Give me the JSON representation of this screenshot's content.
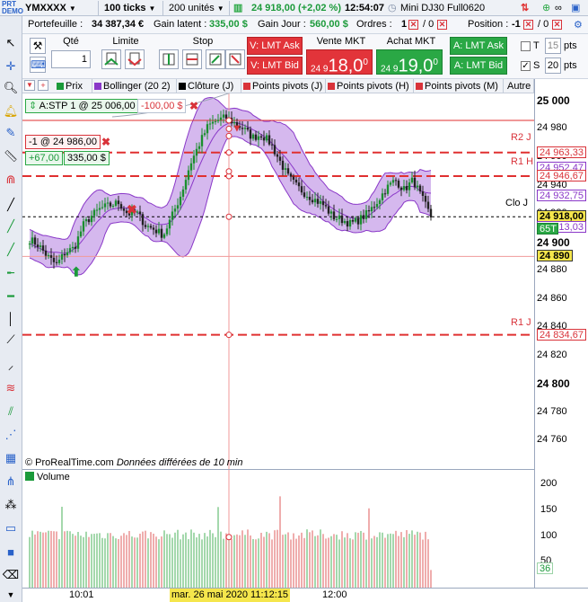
{
  "topbar": {
    "symbol": "YMXXXX",
    "ticks": "100 ticks",
    "units": "200 unités",
    "price_change": "24 918,00 (+2,02 %)",
    "time": "12:54:07",
    "instrument": "Mini DJ30 Full0620"
  },
  "info": {
    "portfolio_label": "Portefeuille :",
    "portfolio_value": "34 387,34 €",
    "latent_label": "Gain latent :",
    "latent_value": "335,00 $",
    "day_label": "Gain Jour :",
    "day_value": "560,00 $",
    "orders_label": "Ordres :",
    "orders_value": "1",
    "orders_sep": "/ 0",
    "position_label": "Position :",
    "position_value": "-1",
    "position_sep": "/ 0"
  },
  "order_panel": {
    "qty_label": "Qté",
    "qty_value": "1",
    "limit_label": "Limite",
    "stop_label": "Stop",
    "sell_header": "Vente MKT",
    "buy_header": "Achat MKT",
    "lmt_ask_left": "V: LMT Ask",
    "lmt_bid_left": "V: LMT Bid",
    "lmt_ask_right": "A: LMT Ask",
    "lmt_bid_right": "A: LMT Bid",
    "sell_price_prefix": "24 9",
    "sell_price_main": "18,0",
    "sell_price_sup": "0",
    "buy_price_prefix": "24 9",
    "buy_price_main": "19,0",
    "buy_price_sup": "0",
    "t_label": "T",
    "t_pts": "15",
    "s_label": "S",
    "s_pts": "20",
    "pts_label": "pts"
  },
  "indicator_tabs": [
    "Prix",
    "Bollinger (20 2)",
    "Clôture (J)",
    "Points pivots (J)",
    "Points pivots (H)",
    "Points pivots (M)",
    "Autre"
  ],
  "overlays": {
    "stop_order": "A:STP  1 @ 25 006,00",
    "stop_pnl": "-100,00 $",
    "position": "-1 @ 24 986,00",
    "pos_pts": "+67,00",
    "pos_pnl": "335,00 $"
  },
  "chart_labels": {
    "r2j": "R2 J",
    "r1h": "R1 H",
    "cloj": "Clo J",
    "r1j": "R1 J",
    "watermark": "© ProRealTime.com",
    "delay": "Données différées de 10 min",
    "volume_title": "Volume"
  },
  "price_axis": {
    "ticks": [
      "25 000",
      "24 980",
      "24 960",
      "24 940",
      "24 920",
      "24 900",
      "24 880",
      "24 860",
      "24 840",
      "24 820",
      "24 800",
      "24 780",
      "24 760"
    ],
    "tags": {
      "r2j": "24 963,33",
      "boll_up": "24 952,47",
      "r1h": "24 946,67",
      "boll_mid": "24 932,75",
      "last": "24 918,00",
      "count": "65T",
      "boll_low": "24 913,03",
      "cursor": "24 890",
      "r1j": "24 834,67"
    }
  },
  "volume_axis": {
    "ticks": [
      "200",
      "150",
      "100",
      "50"
    ],
    "last": "36"
  },
  "time_axis": {
    "t1": "10:01",
    "cursor": "mar. 26 mai 2020 11:12:15",
    "t2": "12:00"
  },
  "chart_data": {
    "type": "candlestick",
    "price_range": [
      24740,
      25005
    ],
    "horizontal_levels": {
      "stop_order": 25006,
      "position_entry": 24986,
      "r2j": 24963.33,
      "r1h": 24946.67,
      "clo_j": 24918,
      "r1j": 24834.67,
      "cursor": 24890
    },
    "bollinger": {
      "upper": 24952.47,
      "mid": 24932.75,
      "lower": 24913.03
    },
    "last": 24918,
    "close_path": [
      24902,
      24898,
      24890,
      24884,
      24893,
      24896,
      24912,
      24919,
      24924,
      24926,
      24928,
      24920,
      24921,
      24912,
      24909,
      24905,
      24919,
      24934,
      24955,
      24969,
      24982,
      24986,
      24988,
      24984,
      24980,
      24974,
      24976,
      24970,
      24958,
      24946,
      24939,
      24934,
      24930,
      24926,
      24918,
      24916,
      24913,
      24916,
      24921,
      24929,
      24938,
      24944,
      24937,
      24944,
      24931,
      24918
    ],
    "volume_range": [
      0,
      220
    ]
  },
  "colors": {
    "bull": "#1a8f2e",
    "bear": "#222222",
    "band": "#c7a0e8",
    "band_line": "#8a38c8",
    "red_line": "#e03030",
    "blue_line": "#2a2ad0"
  }
}
